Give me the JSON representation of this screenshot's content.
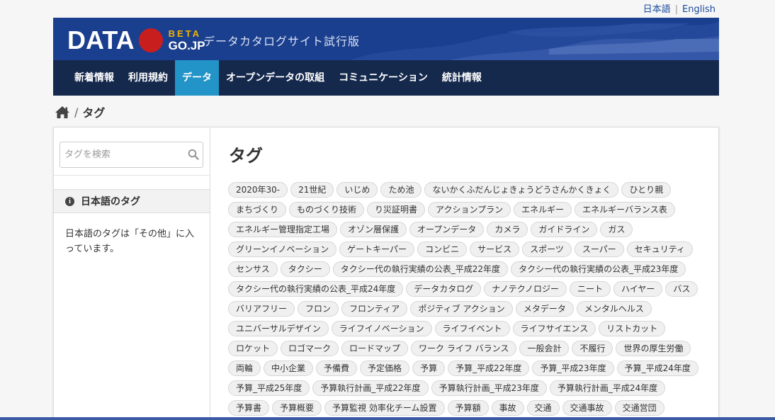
{
  "lang": {
    "ja": "日本語",
    "en": "English"
  },
  "header": {
    "brand_word": "DATA",
    "brand_beta": "BETA",
    "brand_gojp": "GO.JP",
    "tagline": "データカタログサイト試行版",
    "colors": {
      "header_bg": "#1b3f8f",
      "nav_bg": "#15294d",
      "active": "#2294c8",
      "sun": "#c81e1e",
      "beta": "#f0b400"
    }
  },
  "nav": {
    "items": [
      {
        "label": "新着情報"
      },
      {
        "label": "利用規約"
      },
      {
        "label": "データ"
      },
      {
        "label": "オープンデータの取組"
      },
      {
        "label": "コミュニケーション"
      },
      {
        "label": "統計情報"
      }
    ],
    "active_index": 2
  },
  "breadcrumb": {
    "home_icon": "home-icon",
    "separator": "/",
    "current": "タグ"
  },
  "sidebar": {
    "search_placeholder": "タグを検索",
    "section_title": "日本語のタグ",
    "section_text": "日本語のタグは「その他」に入っています。"
  },
  "main": {
    "title": "タグ",
    "tags": [
      "2020年30-",
      "21世紀",
      "いじめ",
      "ため池",
      "ないかくふだんじょきょうどうさんかくきょく",
      "ひとり親",
      "まちづくり",
      "ものづくり技術",
      "り災証明書",
      "アクションプラン",
      "エネルギー",
      "エネルギーバランス表",
      "エネルギー管理指定工場",
      "オゾン層保護",
      "オープンデータ",
      "カメラ",
      "ガイドライン",
      "ガス",
      "グリーンイノベーション",
      "ゲートキーパー",
      "コンビニ",
      "サービス",
      "スポーツ",
      "スーパー",
      "セキュリティ",
      "センサス",
      "タクシー",
      "タクシー代の執行実績の公表_平成22年度",
      "タクシー代の執行実績の公表_平成23年度",
      "タクシー代の執行実績の公表_平成24年度",
      "データカタログ",
      "ナノテクノロジー",
      "ニート",
      "ハイヤー",
      "バス",
      "バリアフリー",
      "フロン",
      "フロンティア",
      "ポジティブ アクション",
      "メタデータ",
      "メンタルヘルス",
      "ユニバーサルデザイン",
      "ライフイノベーション",
      "ライフイベント",
      "ライフサイエンス",
      "リストカット",
      "ロケット",
      "ロゴマーク",
      "ロードマップ",
      "ワーク ライフ バランス",
      "一般会計",
      "不履行",
      "世界の厚生労働",
      "両輪",
      "中小企業",
      "予備費",
      "予定価格",
      "予算",
      "予算_平成22年度",
      "予算_平成23年度",
      "予算_平成24年度",
      "予算_平成25年度",
      "予算執行計画_平成22年度",
      "予算執行計画_平成23年度",
      "予算執行計画_平成24年度",
      "予算書",
      "予算概要",
      "予算監視 効率化チーム設置",
      "予算額",
      "事故",
      "交通",
      "交通事故",
      "交通営団"
    ]
  }
}
